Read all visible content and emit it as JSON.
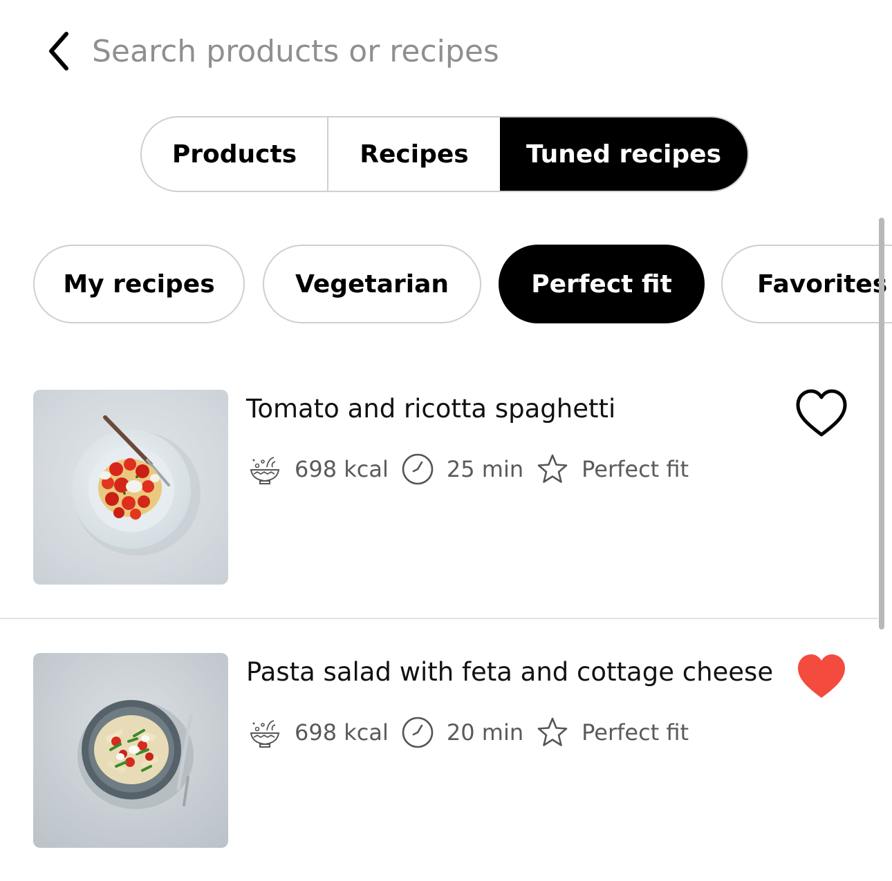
{
  "search": {
    "placeholder": "Search products or recipes"
  },
  "segments": [
    {
      "label": "Products",
      "selected": false
    },
    {
      "label": "Recipes",
      "selected": false
    },
    {
      "label": "Tuned recipes",
      "selected": true
    }
  ],
  "chips": [
    {
      "label": "My recipes",
      "selected": false
    },
    {
      "label": "Vegetarian",
      "selected": false
    },
    {
      "label": "Perfect fit",
      "selected": true
    },
    {
      "label": "Favorites",
      "selected": false
    }
  ],
  "recipes": [
    {
      "title": "Tomato and ricotta spaghetti",
      "kcal": "698 kcal",
      "time": "25 min",
      "fit": "Perfect fit",
      "favorite": false
    },
    {
      "title": "Pasta salad with feta and cottage cheese",
      "kcal": "698 kcal",
      "time": "20 min",
      "fit": "Perfect fit",
      "favorite": true
    }
  ],
  "icons": {
    "back": "chevron-left-icon",
    "calories": "salad-bowl-icon",
    "time": "clock-icon",
    "fit": "star-icon",
    "favorite": "heart-icon"
  },
  "colors": {
    "accent": "#000000",
    "favorite": "#f44b3f",
    "muted_text": "#5a5a5a",
    "placeholder": "#8f8f8f",
    "border": "#cfcfcf"
  }
}
